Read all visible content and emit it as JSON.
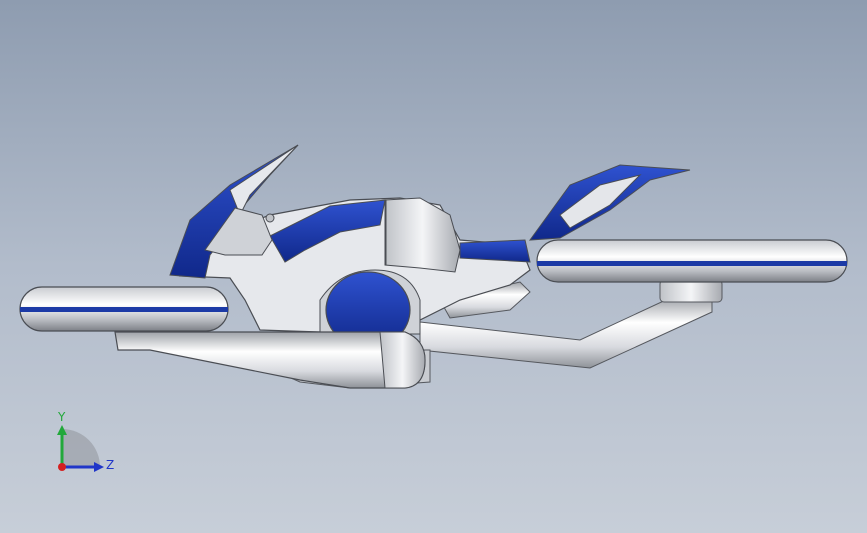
{
  "viewport": {
    "background_top": "#8e9cb0",
    "background_bottom": "#c7ced8"
  },
  "model": {
    "body_color": "#e4e6ea",
    "accent_color": "#1c3aa6",
    "shadow_color": "#9a9da4"
  },
  "triad": {
    "y_label": "Y",
    "z_label": "Z",
    "y_color": "#22a83a",
    "z_color": "#2036c8",
    "origin_color": "#d42020"
  }
}
